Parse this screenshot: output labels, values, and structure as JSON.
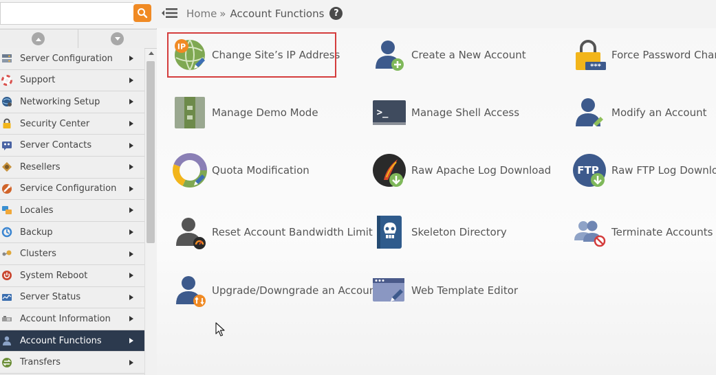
{
  "search": {
    "placeholder": "",
    "value": ""
  },
  "header": {
    "breadcrumb_home": "Home",
    "breadcrumb_sep": "»",
    "breadcrumb_current": "Account Functions",
    "help_label": "?"
  },
  "sidebar": {
    "items": [
      {
        "label": "Server Configuration",
        "icon": "server-config-icon"
      },
      {
        "label": "Support",
        "icon": "lifebuoy-icon"
      },
      {
        "label": "Networking Setup",
        "icon": "network-icon"
      },
      {
        "label": "Security Center",
        "icon": "padlock-icon"
      },
      {
        "label": "Server Contacts",
        "icon": "contacts-icon"
      },
      {
        "label": "Resellers",
        "icon": "resellers-icon"
      },
      {
        "label": "Service Configuration",
        "icon": "service-config-icon"
      },
      {
        "label": "Locales",
        "icon": "locales-icon"
      },
      {
        "label": "Backup",
        "icon": "backup-icon"
      },
      {
        "label": "Clusters",
        "icon": "clusters-icon"
      },
      {
        "label": "System Reboot",
        "icon": "power-icon"
      },
      {
        "label": "Server Status",
        "icon": "server-status-icon"
      },
      {
        "label": "Account Information",
        "icon": "account-info-icon"
      },
      {
        "label": "Account Functions",
        "icon": "account-functions-icon",
        "active": true
      },
      {
        "label": "Transfers",
        "icon": "transfers-icon"
      }
    ]
  },
  "main": {
    "tiles": [
      {
        "label": "Change Site’s IP Address",
        "icon": "change-ip-icon",
        "selected": true
      },
      {
        "label": "Create a New Account",
        "icon": "create-account-icon"
      },
      {
        "label": "Force Password Chang",
        "icon": "force-password-icon"
      },
      {
        "label": "Manage Demo Mode",
        "icon": "demo-mode-icon"
      },
      {
        "label": "Manage Shell Access",
        "icon": "shell-access-icon"
      },
      {
        "label": "Modify an Account",
        "icon": "modify-account-icon"
      },
      {
        "label": "Quota Modification",
        "icon": "quota-icon"
      },
      {
        "label": "Raw Apache Log Download",
        "icon": "apache-log-icon"
      },
      {
        "label": "Raw FTP Log Downloa",
        "icon": "ftp-log-icon",
        "icon_text": "FTP"
      },
      {
        "label": "Reset Account Bandwidth Limit",
        "icon": "bandwidth-icon"
      },
      {
        "label": "Skeleton Directory",
        "icon": "skeleton-directory-icon"
      },
      {
        "label": "Terminate Accounts",
        "icon": "terminate-accounts-icon"
      },
      {
        "label": "Upgrade/Downgrade an Account",
        "icon": "upgrade-downgrade-icon"
      },
      {
        "label": "Web Template Editor",
        "icon": "web-template-icon"
      }
    ],
    "ip_badge": "IP",
    "shell_prompt": ">_",
    "password_dots": "***"
  },
  "colors": {
    "accent_orange": "#f08a24",
    "active_nav": "#2c3a4e",
    "selection_outline": "#d43c3c",
    "user_blue": "#3d5a8c"
  }
}
